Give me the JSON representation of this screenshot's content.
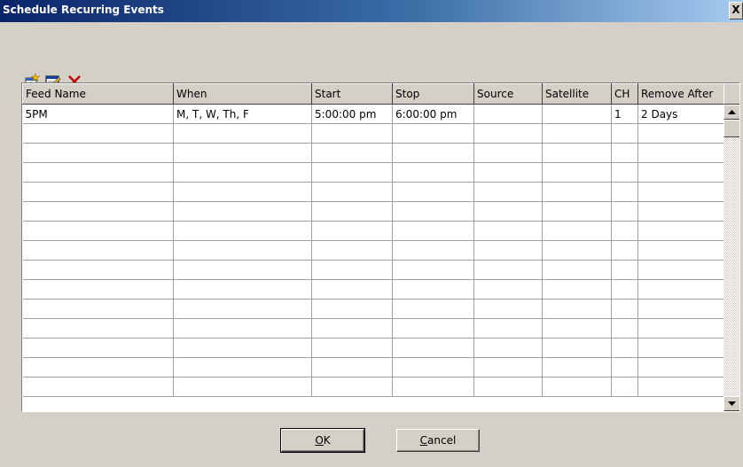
{
  "window": {
    "title": "Schedule Recurring Events",
    "close_label": "X"
  },
  "toolbar": {
    "buttons": [
      {
        "icon": "add-event-icon"
      },
      {
        "icon": "edit-event-icon"
      },
      {
        "icon": "delete-event-icon"
      }
    ]
  },
  "grid": {
    "columns": [
      "Feed Name",
      "When",
      "Start",
      "Stop",
      "Source",
      "Satellite",
      "CH",
      "Remove After"
    ],
    "rows": [
      [
        "5PM",
        "M, T, W, Th, F",
        "5:00:00 pm",
        "6:00:00 pm",
        "",
        "",
        "1",
        "2 Days"
      ]
    ]
  },
  "buttons": {
    "ok": {
      "mnemonic": "O",
      "rest": "K"
    },
    "cancel": {
      "mnemonic": "C",
      "rest": "ancel"
    }
  }
}
